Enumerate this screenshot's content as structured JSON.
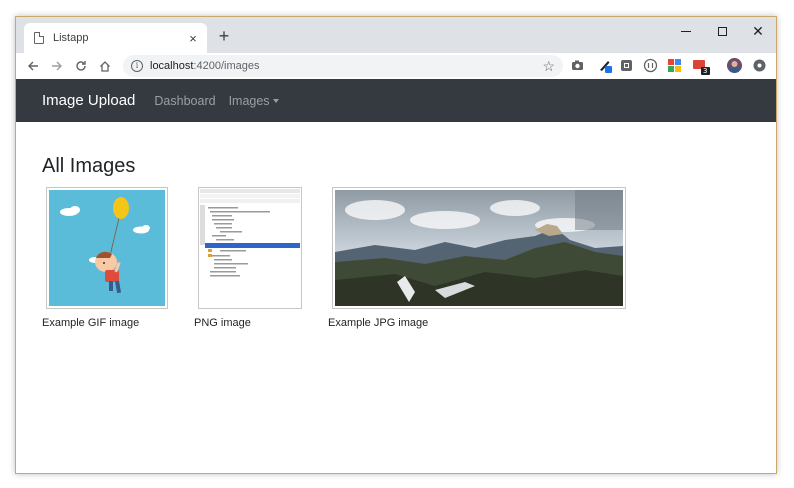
{
  "browser": {
    "tab_title": "Listapp",
    "close_glyph": "×",
    "new_tab_glyph": "+",
    "url_host": "localhost",
    "url_path": ":4200/images",
    "info_glyph": "i",
    "star_glyph": "☆",
    "ext_badge": "3",
    "window_close_glyph": "✕",
    "nav_icons": [
      "back-arrow-icon",
      "forward-arrow-icon",
      "reload-icon",
      "home-icon"
    ],
    "extension_icons": [
      "camera-icon",
      "pen-icon",
      "shield-icon",
      "circle-icon",
      "google-icon",
      "mail-icon",
      "avatar-icon",
      "menu-dot-icon"
    ]
  },
  "navbar": {
    "brand": "Image Upload",
    "links": [
      {
        "label": "Dashboard"
      },
      {
        "label": "Images"
      }
    ],
    "bg_color": "#343a40"
  },
  "main": {
    "title": "All Images",
    "images": [
      {
        "caption": "Example GIF image",
        "kind": "cartoon-balloon-illustration"
      },
      {
        "caption": "PNG image",
        "kind": "ide-project-tree-screenshot"
      },
      {
        "caption": "Example JPG image",
        "kind": "mountain-panorama-photo"
      }
    ]
  }
}
